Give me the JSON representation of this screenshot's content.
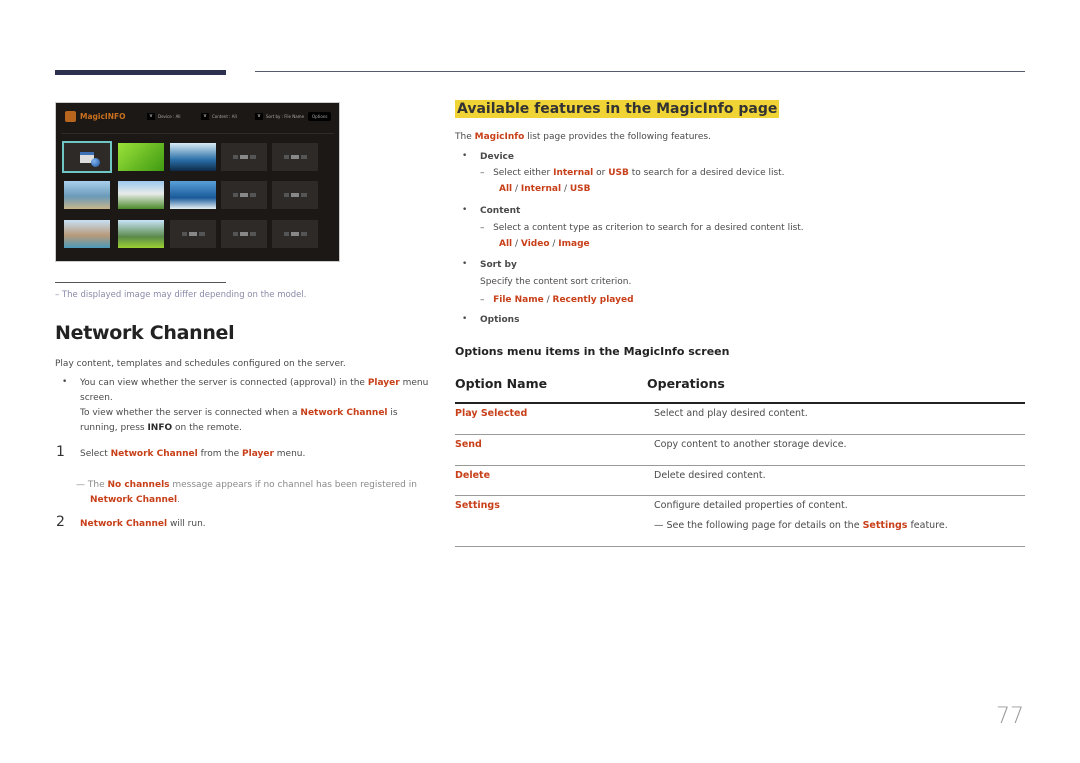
{
  "magicinfo_screen": {
    "logo_text": "MagicINFO",
    "filters": [
      "Device : All",
      "Content : All",
      "Sort by : File Name"
    ],
    "options_label": "Options",
    "tiles": [
      [
        "schedule",
        "image-leaves",
        "image-birds",
        "empty",
        "empty"
      ],
      [
        "image-children",
        "image-flowers",
        "image-wave",
        "empty",
        "empty"
      ],
      [
        "image-family",
        "image-field",
        "empty",
        "empty",
        "empty"
      ]
    ]
  },
  "note_model": "The displayed image may differ depending on the model.",
  "network_channel": {
    "title": "Network Channel",
    "intro": "Play content, templates and schedules configured on the server.",
    "bullet": {
      "t1": "You can view whether the server is connected (approval) in the ",
      "h1": "Player",
      "t2": " menu screen.",
      "t3": "To view whether the server is connected when a ",
      "h2": "Network Channel",
      "t4": " is running, press ",
      "b1": "INFO",
      "t5": " on the remote."
    },
    "step1": {
      "num": "1",
      "t1": "Select ",
      "h1": "Network Channel",
      "t2": " from the ",
      "h2": "Player",
      "t3": " menu."
    },
    "step1_note": {
      "t1": "The ",
      "h1": "No channels",
      "t2": " message appears if no channel has been registered in ",
      "h2": "Network Channel",
      "t3": "."
    },
    "step2": {
      "num": "2",
      "h1": "Network Channel",
      "t1": " will run."
    }
  },
  "features": {
    "title": "Available features in the MagicInfo page",
    "intro": {
      "t1": "The ",
      "h1": "MagicInfo",
      "t2": " list page provides the following features."
    },
    "device": {
      "label": "Device",
      "d1": "Select either ",
      "h1": "Internal",
      "d2": " or ",
      "h2": "USB",
      "d3": " to search for a desired device list.",
      "opts": [
        "All",
        "Internal",
        "USB"
      ]
    },
    "content": {
      "label": "Content",
      "d1": "Select a content type as criterion to search for a desired content list.",
      "opts": [
        "All",
        "Video",
        "Image"
      ]
    },
    "sortby": {
      "label": "Sort by",
      "d1": "Specify the content sort criterion.",
      "opts": [
        "File Name",
        "Recently played"
      ]
    },
    "options": {
      "label": "Options"
    }
  },
  "options_menu": {
    "title": "Options menu items in the MagicInfo screen",
    "headers": [
      "Option Name",
      "Operations"
    ],
    "rows": [
      {
        "name": "Play Selected",
        "desc": "Select and play desired content."
      },
      {
        "name": "Send",
        "desc": "Copy content to another storage device."
      },
      {
        "name": "Delete",
        "desc": "Delete desired content."
      },
      {
        "name": "Settings",
        "desc": "Configure detailed properties of content.",
        "note_t1": "See the following page for details on the ",
        "note_h1": "Settings",
        "note_t2": " feature."
      }
    ]
  },
  "page_number": "77"
}
